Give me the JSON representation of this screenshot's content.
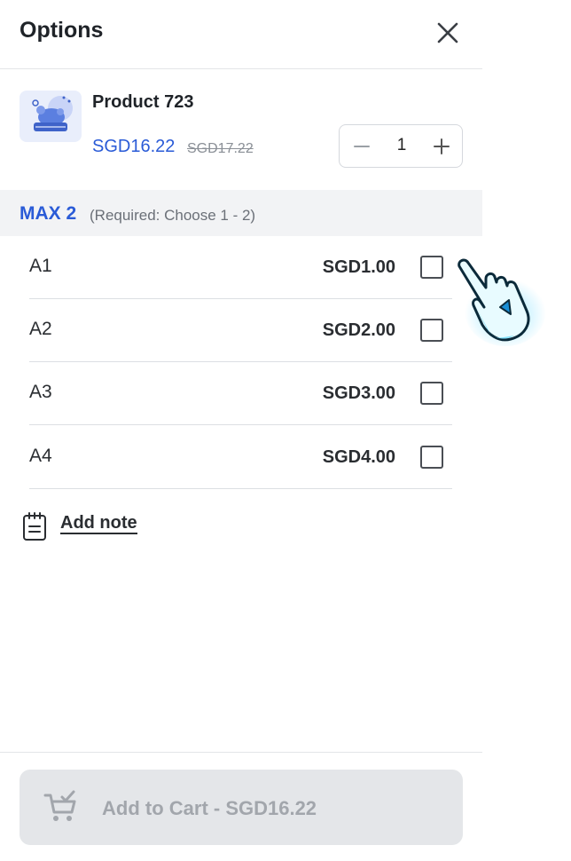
{
  "header": {
    "title": "Options",
    "close_icon": "close-icon"
  },
  "product": {
    "name": "Product 723",
    "price": "SGD16.22",
    "old_price": "SGD17.22",
    "thumbnail_icon": "food-dish-icon",
    "quantity": "1"
  },
  "option_group": {
    "max_label": "MAX 2",
    "requirement": "(Required: Choose 1 - 2)",
    "options": [
      {
        "label": "A1",
        "price": "SGD1.00",
        "checked": false
      },
      {
        "label": "A2",
        "price": "SGD2.00",
        "checked": false
      },
      {
        "label": "A3",
        "price": "SGD3.00",
        "checked": false
      },
      {
        "label": "A4",
        "price": "SGD4.00",
        "checked": false
      }
    ]
  },
  "note": {
    "label": "Add note",
    "icon": "notepad-icon"
  },
  "cart_button": {
    "label": "Add to Cart - SGD16.22",
    "icon": "cart-check-icon",
    "state": "disabled"
  },
  "colors": {
    "accent": "#2a5bd7",
    "disabled_bg": "#e4e6e9",
    "disabled_text": "#a2a6ac",
    "group_bg": "#f2f3f5"
  }
}
